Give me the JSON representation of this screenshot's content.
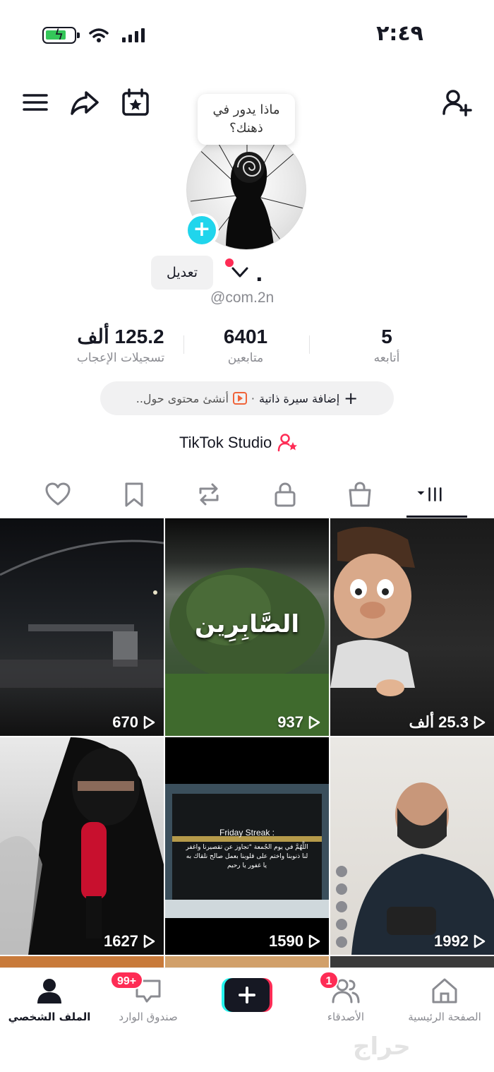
{
  "status_bar": {
    "time": "٢:٤٩"
  },
  "bubble": {
    "text": "ماذا يدور في ذهنك؟"
  },
  "profile": {
    "edit_label": "تعديل",
    "display_name": ".",
    "handle": "@com.2n"
  },
  "stats": [
    {
      "value": "5",
      "label": "أتابعه"
    },
    {
      "value": "6401",
      "label": "متابعين"
    },
    {
      "value": "125.2 ألف",
      "label": "تسجيلات الإعجاب"
    }
  ],
  "bio": {
    "add_label": "إضافة سيرة ذاتية",
    "separator": "·",
    "create_label": "أنشئ محتوى حول.."
  },
  "studio": {
    "label": "TikTok Studio"
  },
  "tabs": [
    "videos-icon",
    "shop-icon",
    "lock-icon",
    "repost-icon",
    "bookmark-icon",
    "heart-icon"
  ],
  "videos": [
    {
      "views": "670"
    },
    {
      "views": "937",
      "overlay": "الصَّابِرِين"
    },
    {
      "views": "25.3 ألف"
    },
    {
      "views": "1627"
    },
    {
      "views": "1590",
      "overlay_title": "Friday Streak :",
      "overlay_text": "اللَّهُمَّ في يوم الجُمعة \"تجاوز عن تقصيرنا واغفر لنا ذنوبنا واختم على قلوبنا بعمل صالح نلقاك به يا غفور يا رحيم"
    },
    {
      "views": "1992"
    }
  ],
  "bottom_nav": {
    "profile": "الملف الشخصي",
    "inbox": "صندوق الوارد",
    "inbox_badge": "99+",
    "friends": "الأصدقاء",
    "friends_badge": "1",
    "home": "الصفحة الرئيسية"
  },
  "watermark": {
    "text": "حراج"
  }
}
